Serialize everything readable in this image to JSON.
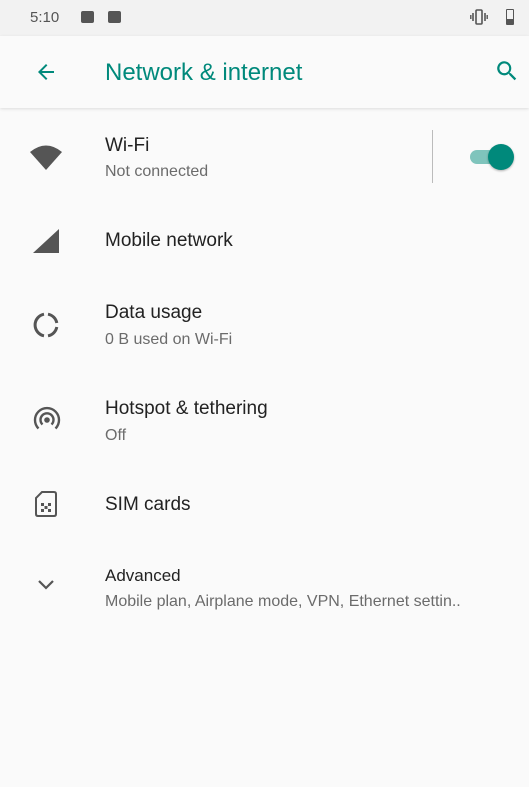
{
  "status_bar": {
    "time": "5:10"
  },
  "app_bar": {
    "title": "Network & internet"
  },
  "accent_color": "#00897b",
  "items": [
    {
      "title": "Wi-Fi",
      "subtitle": "Not connected",
      "icon": "wifi-icon",
      "toggle_on": true
    },
    {
      "title": "Mobile network",
      "icon": "signal-icon"
    },
    {
      "title": "Data usage",
      "subtitle": "0 B used on Wi-Fi",
      "icon": "data-usage-icon"
    },
    {
      "title": "Hotspot & tethering",
      "subtitle": "Off",
      "icon": "hotspot-icon"
    },
    {
      "title": "SIM cards",
      "icon": "sim-card-icon"
    },
    {
      "title": "Advanced",
      "subtitle": "Mobile plan, Airplane mode, VPN, Ethernet settin..",
      "icon": "chevron-down-icon"
    }
  ]
}
